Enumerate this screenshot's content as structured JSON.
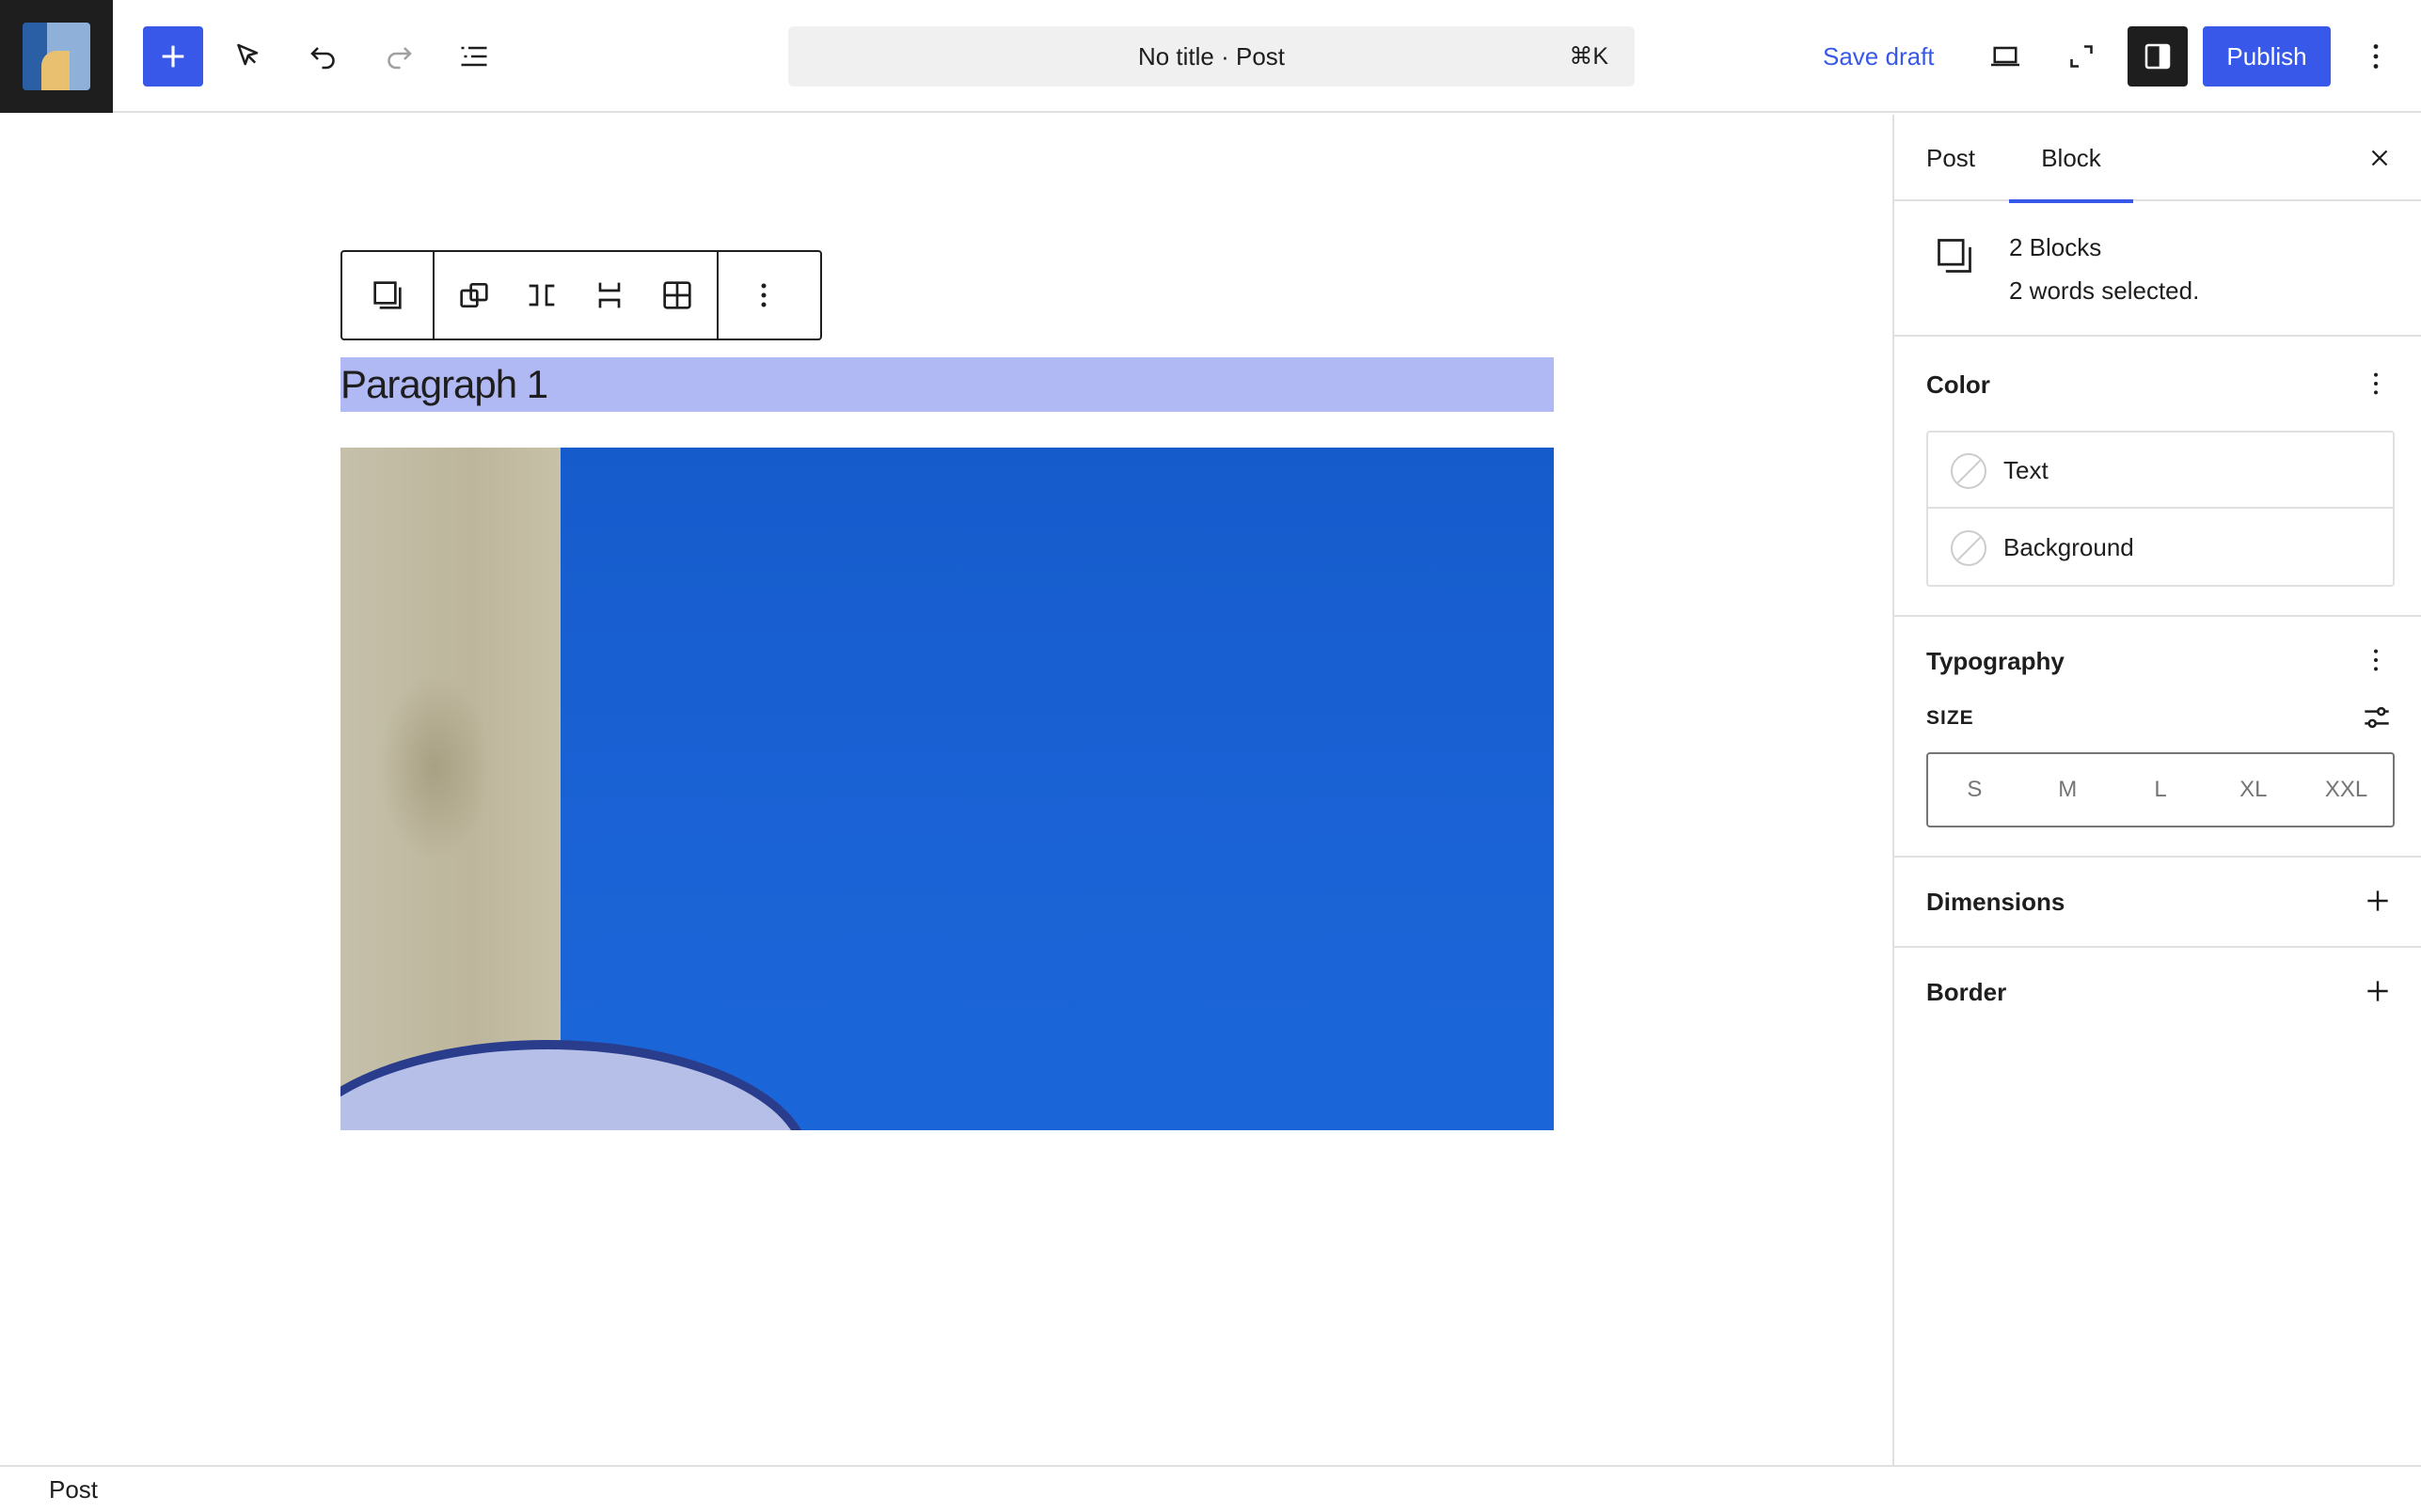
{
  "header": {
    "add_block_icon": "plus-icon",
    "tools": [
      "select-tool-icon",
      "undo-icon",
      "redo-icon",
      "document-overview-icon"
    ],
    "command": {
      "title": "No title · Post",
      "shortcut": "⌘K"
    },
    "save_draft_label": "Save draft",
    "publish_label": "Publish",
    "icons": [
      "preview-desktop-icon",
      "fullscreen-icon",
      "settings-sidebar-icon",
      "options-menu-icon"
    ]
  },
  "colors": {
    "accent": "#3858e9",
    "selection": "#b0b9f4",
    "dark": "#1e1e1e",
    "border": "#e0e0e0"
  },
  "canvas": {
    "paragraph_text": "Paragraph 1",
    "block_toolbar_icons": [
      "multi-block-icon",
      "group-icon",
      "row-icon",
      "stack-icon",
      "grid-icon",
      "more-options-icon"
    ]
  },
  "sidebar": {
    "tabs": [
      {
        "label": "Post"
      },
      {
        "label": "Block"
      }
    ],
    "active_tab": "Block",
    "block_card": {
      "title": "2 Blocks",
      "description": "2 words selected."
    },
    "color_panel": {
      "title": "Color",
      "items": [
        {
          "label": "Text"
        },
        {
          "label": "Background"
        }
      ]
    },
    "typography_panel": {
      "title": "Typography",
      "size_label": "SIZE",
      "sizes": [
        "S",
        "M",
        "L",
        "XL",
        "XXL"
      ]
    },
    "dimensions_title": "Dimensions",
    "border_title": "Border"
  },
  "footer": {
    "breadcrumb": "Post"
  }
}
